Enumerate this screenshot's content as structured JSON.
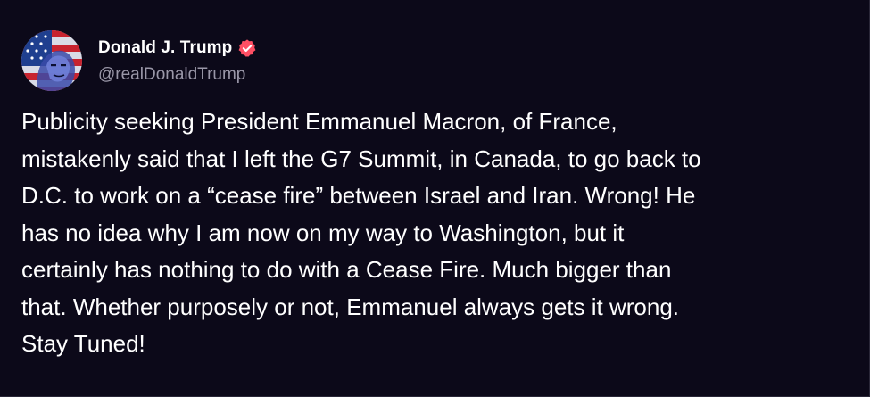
{
  "post": {
    "author": {
      "display_name": "Donald J. Trump",
      "handle": "@realDonaldTrump",
      "verified_icon": "verified-badge-icon",
      "avatar_icon": "avatar-image"
    },
    "body_lines": [
      "Publicity seeking President Emmanuel Macron, of France,",
      "mistakenly said that I left the G7 Summit, in Canada, to go back to",
      "D.C. to work on a “cease fire” between Israel and Iran. Wrong! He",
      "has no idea why I am now on my way to Washington, but it",
      "certainly has nothing to do with a Cease Fire. Much bigger than",
      "that. Whether purposely or not, Emmanuel always gets it wrong.",
      "Stay Tuned!"
    ]
  },
  "colors": {
    "background": "#0c0919",
    "text": "#ffffff",
    "handle": "#9a97a8",
    "badge": "#ff4f64"
  }
}
